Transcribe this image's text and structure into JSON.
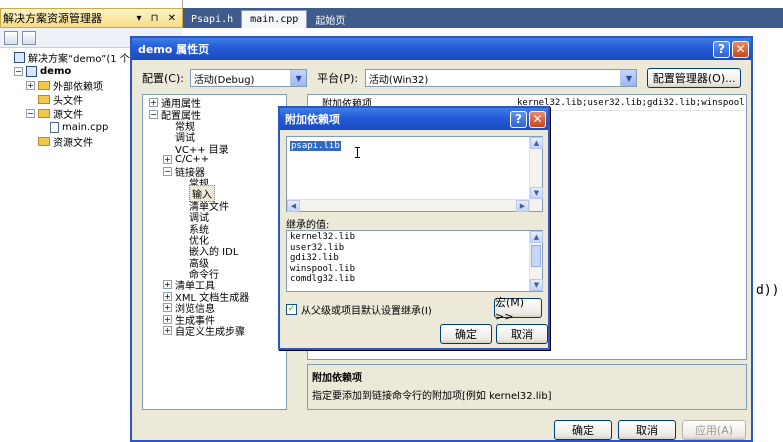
{
  "solution_explorer": {
    "title": "解决方案资源管理器",
    "pin": "▾ ⊓ ✕",
    "tree": [
      {
        "label": "解决方案“demo”(1 个项",
        "indent": 0,
        "icon": "solution-icon",
        "toggle": ""
      },
      {
        "label": "demo",
        "indent": 1,
        "icon": "project-icon",
        "toggle": "−",
        "bold": true
      },
      {
        "label": "外部依赖项",
        "indent": 2,
        "icon": "folder-icon",
        "toggle": "+"
      },
      {
        "label": "头文件",
        "indent": 2,
        "icon": "folder-icon",
        "toggle": ""
      },
      {
        "label": "源文件",
        "indent": 2,
        "icon": "folder-icon",
        "toggle": "−"
      },
      {
        "label": "main.cpp",
        "indent": 3,
        "icon": "cpp-file-icon",
        "toggle": ""
      },
      {
        "label": "资源文件",
        "indent": 2,
        "icon": "folder-icon",
        "toggle": ""
      }
    ]
  },
  "editor": {
    "tabs": [
      {
        "label": "Psapi.h",
        "active": false,
        "plain": false
      },
      {
        "label": "main.cpp",
        "active": true,
        "plain": false
      },
      {
        "label": "起始页",
        "active": false,
        "plain": true
      }
    ],
    "visible_code": "d))"
  },
  "property_dialog": {
    "title": "demo 属性页",
    "help": "?",
    "close": "✕",
    "config_label": "配置(C):",
    "config_value": "活动(Debug)",
    "platform_label": "平台(P):",
    "platform_value": "活动(Win32)",
    "config_manager": "配置管理器(O)...",
    "tree": [
      {
        "label": "通用属性",
        "indent": 0,
        "toggle": "+"
      },
      {
        "label": "配置属性",
        "indent": 0,
        "toggle": "−"
      },
      {
        "label": "常规",
        "indent": 1,
        "toggle": ""
      },
      {
        "label": "调试",
        "indent": 1,
        "toggle": ""
      },
      {
        "label": "VC++ 目录",
        "indent": 1,
        "toggle": ""
      },
      {
        "label": "C/C++",
        "indent": 1,
        "toggle": "+"
      },
      {
        "label": "链接器",
        "indent": 1,
        "toggle": "−"
      },
      {
        "label": "常规",
        "indent": 2,
        "toggle": ""
      },
      {
        "label": "输入",
        "indent": 2,
        "toggle": "",
        "selected": true
      },
      {
        "label": "清单文件",
        "indent": 2,
        "toggle": ""
      },
      {
        "label": "调试",
        "indent": 2,
        "toggle": ""
      },
      {
        "label": "系统",
        "indent": 2,
        "toggle": ""
      },
      {
        "label": "优化",
        "indent": 2,
        "toggle": ""
      },
      {
        "label": "嵌入的 IDL",
        "indent": 2,
        "toggle": ""
      },
      {
        "label": "高级",
        "indent": 2,
        "toggle": ""
      },
      {
        "label": "命令行",
        "indent": 2,
        "toggle": ""
      },
      {
        "label": "清单工具",
        "indent": 1,
        "toggle": "+"
      },
      {
        "label": "XML 文档生成器",
        "indent": 1,
        "toggle": "+"
      },
      {
        "label": "浏览信息",
        "indent": 1,
        "toggle": "+"
      },
      {
        "label": "生成事件",
        "indent": 1,
        "toggle": "+"
      },
      {
        "label": "自定义生成步骤",
        "indent": 1,
        "toggle": "+"
      }
    ],
    "grid_rows": [
      {
        "name": "附加依赖项",
        "value": "kernel32.lib;user32.lib;gdi32.lib;winspool.li"
      }
    ],
    "description_title": "附加依赖项",
    "description_text": "指定要添加到链接命令行的附加项[例如 kernel32.lib]",
    "ok": "确定",
    "cancel": "取消",
    "apply": "应用(A)"
  },
  "dependency_dialog": {
    "title": "附加依赖项",
    "help": "?",
    "close": "✕",
    "edit_value": "psapi.lib",
    "inherited_label": "继承的值:",
    "inherited": [
      "kernel32.lib",
      "user32.lib",
      "gdi32.lib",
      "winspool.lib",
      "comdlg32.lib"
    ],
    "inherit_checkbox": "从父级或项目默认设置继承(I)",
    "inherit_checked": true,
    "check_mark": "✓",
    "macro_button": "宏(M) >>",
    "ok": "确定",
    "cancel": "取消"
  }
}
